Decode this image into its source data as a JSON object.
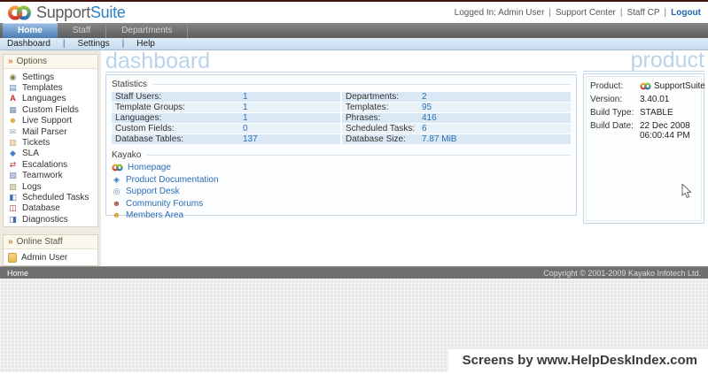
{
  "colors": {
    "accent_blue": "#2f7fc1",
    "link_blue": "#2a6db5",
    "title_blue": "#b9d4ea",
    "active_tab": "#4a7cb4",
    "chevron_orange": "#e07f26"
  },
  "separator": "|",
  "logo": {
    "part1": "Support",
    "part2": "Suite"
  },
  "login": {
    "logged_in": "Logged In: Admin User",
    "support_center": "Support Center",
    "staff_cp": "Staff CP",
    "logout": "Logout"
  },
  "nav": {
    "tabs": [
      {
        "label": "Home"
      },
      {
        "label": "Staff"
      },
      {
        "label": "Departments"
      }
    ]
  },
  "subnav": {
    "items": [
      {
        "label": "Dashboard"
      },
      {
        "label": "Settings"
      },
      {
        "label": "Help"
      }
    ]
  },
  "sidebar": {
    "options": {
      "header": "Options",
      "items": [
        {
          "label": "Settings",
          "icon": "settings-icon",
          "glyph": "◉"
        },
        {
          "label": "Templates",
          "icon": "templates-icon",
          "glyph": "▤"
        },
        {
          "label": "Languages",
          "icon": "languages-icon",
          "glyph": "A"
        },
        {
          "label": "Custom Fields",
          "icon": "custom-fields-icon",
          "glyph": "▦"
        },
        {
          "label": "Live Support",
          "icon": "live-support-icon",
          "glyph": "☻"
        },
        {
          "label": "Mail Parser",
          "icon": "mail-parser-icon",
          "glyph": "✉"
        },
        {
          "label": "Tickets",
          "icon": "tickets-icon",
          "glyph": "▥"
        },
        {
          "label": "SLA",
          "icon": "sla-icon",
          "glyph": "◆"
        },
        {
          "label": "Escalations",
          "icon": "escalations-icon",
          "glyph": "⇄"
        },
        {
          "label": "Teamwork",
          "icon": "teamwork-icon",
          "glyph": "▧"
        },
        {
          "label": "Logs",
          "icon": "logs-icon",
          "glyph": "▨"
        },
        {
          "label": "Scheduled Tasks",
          "icon": "scheduled-tasks-icon",
          "glyph": "◧"
        },
        {
          "label": "Database",
          "icon": "database-icon",
          "glyph": "◫"
        },
        {
          "label": "Diagnostics",
          "icon": "diagnostics-icon",
          "glyph": "◨"
        }
      ]
    },
    "online_staff": {
      "header": "Online Staff",
      "items": [
        {
          "label": "Admin User",
          "icon": "admin-user-icon"
        }
      ]
    }
  },
  "main": {
    "title": "dashboard",
    "stats": {
      "header": "Statistics",
      "rows": [
        {
          "l_label": "Staff Users:",
          "l_value": "1",
          "r_label": "Departments:",
          "r_value": "2"
        },
        {
          "l_label": "Template Groups:",
          "l_value": "1",
          "r_label": "Templates:",
          "r_value": "95"
        },
        {
          "l_label": "Languages:",
          "l_value": "1",
          "r_label": "Phrases:",
          "r_value": "416"
        },
        {
          "l_label": "Custom Fields:",
          "l_value": "0",
          "r_label": "Scheduled Tasks:",
          "r_value": "6"
        },
        {
          "l_label": "Database Tables:",
          "l_value": "137",
          "r_label": "Database Size:",
          "r_value": "7.87 MiB"
        }
      ]
    },
    "kayako": {
      "header": "Kayako",
      "links": [
        {
          "label": "Homepage",
          "icon": "homepage-icon",
          "glyph": ""
        },
        {
          "label": "Product Documentation",
          "icon": "product-documentation-icon",
          "glyph": "◈"
        },
        {
          "label": "Support Desk",
          "icon": "support-desk-icon",
          "glyph": "◎"
        },
        {
          "label": "Community Forums",
          "icon": "community-forums-icon",
          "glyph": "☻"
        },
        {
          "label": "Members Area",
          "icon": "members-area-icon",
          "glyph": "☻"
        }
      ]
    }
  },
  "product": {
    "title": "product",
    "rows": [
      {
        "label": "Product:",
        "value": "SupportSuite",
        "icon": "kayako-mini-icon"
      },
      {
        "label": "Version:",
        "value": "3.40.01"
      },
      {
        "label": "Build Type:",
        "value": "STABLE"
      },
      {
        "label": "Build Date:",
        "value": "22 Dec 2008 06:00:44 PM"
      }
    ]
  },
  "footer": {
    "home": "Home",
    "copyright": "Copyright © 2001-2009 Kayako Infotech Ltd."
  },
  "watermark": {
    "text": "Screens by www.HelpDeskIndex.com"
  }
}
